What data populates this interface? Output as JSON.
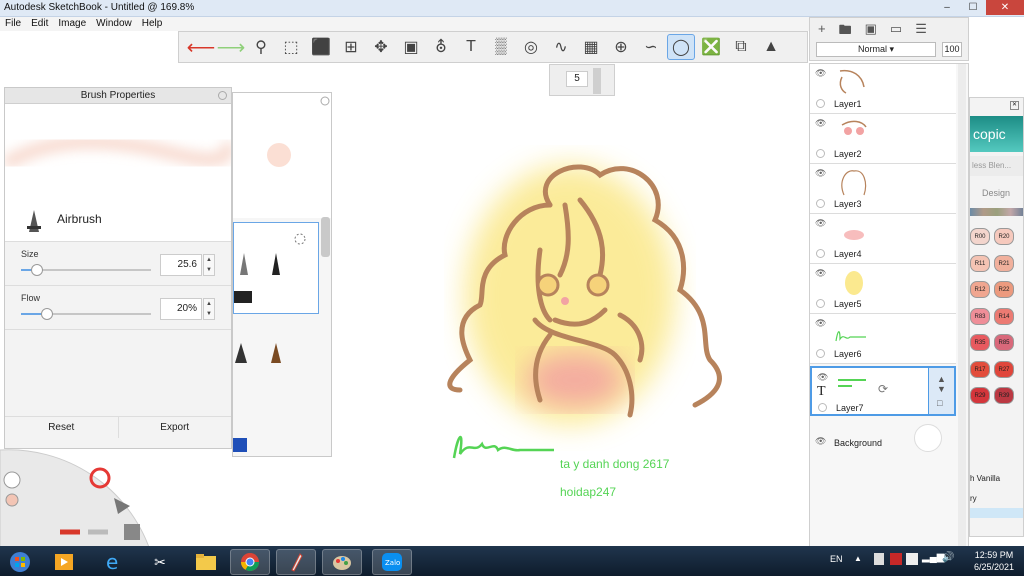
{
  "window": {
    "title": "Autodesk SketchBook - Untitled @ 169.8%",
    "controls": [
      "–",
      "☐",
      "✕"
    ]
  },
  "menu": [
    "File",
    "Edit",
    "Image",
    "Window",
    "Help"
  ],
  "brush_size_puck": {
    "value": "5"
  },
  "brush_properties": {
    "title": "Brush Properties",
    "brush_name": "Airbrush",
    "size": {
      "label": "Size",
      "value": "25.6",
      "fraction": 0.12
    },
    "flow": {
      "label": "Flow",
      "value": "20%",
      "fraction": 0.2
    },
    "reset_label": "Reset",
    "export_label": "Export"
  },
  "canvas": {
    "text_lines": [
      "ta y danh dong 2617",
      "hoidap247"
    ]
  },
  "layers": {
    "blend_mode": "Normal",
    "opacity": "100",
    "items": [
      {
        "name": "Layer1"
      },
      {
        "name": "Layer2"
      },
      {
        "name": "Layer3"
      },
      {
        "name": "Layer4"
      },
      {
        "name": "Layer5"
      },
      {
        "name": "Layer6"
      },
      {
        "name": "Layer7"
      }
    ],
    "background_label": "Background"
  },
  "copic": {
    "logo_text": "copic",
    "search_placeholder": "less Blen...",
    "design_label": "Design",
    "swatches": [
      {
        "code": "R00",
        "color": "#f3d5cd"
      },
      {
        "code": "R20",
        "color": "#f6c9bd"
      },
      {
        "code": "R11",
        "color": "#f4c3b3"
      },
      {
        "code": "R21",
        "color": "#f1b09c"
      },
      {
        "code": "R12",
        "color": "#f0a690"
      },
      {
        "code": "R22",
        "color": "#ec9a7e"
      },
      {
        "code": "R83",
        "color": "#ef8e98"
      },
      {
        "code": "R14",
        "color": "#ec7a72"
      },
      {
        "code": "R35",
        "color": "#e85a5f"
      },
      {
        "code": "R85",
        "color": "#d9687a"
      },
      {
        "code": "R17",
        "color": "#e24d3c"
      },
      {
        "code": "R27",
        "color": "#e0463b"
      },
      {
        "code": "R29",
        "color": "#d4363b"
      },
      {
        "code": "R39",
        "color": "#bb3842"
      }
    ],
    "list_text": [
      "h Vanilla",
      "ry"
    ]
  },
  "taskbar": {
    "language": "EN",
    "time": "12:59 PM",
    "date": "6/25/2021"
  },
  "colors": {
    "accent": "#6aa6e6",
    "hair_stroke": "#b7835c",
    "hair_fill": "#fbe98f",
    "blush": "#f3a1a1",
    "text_green": "#55d455"
  }
}
